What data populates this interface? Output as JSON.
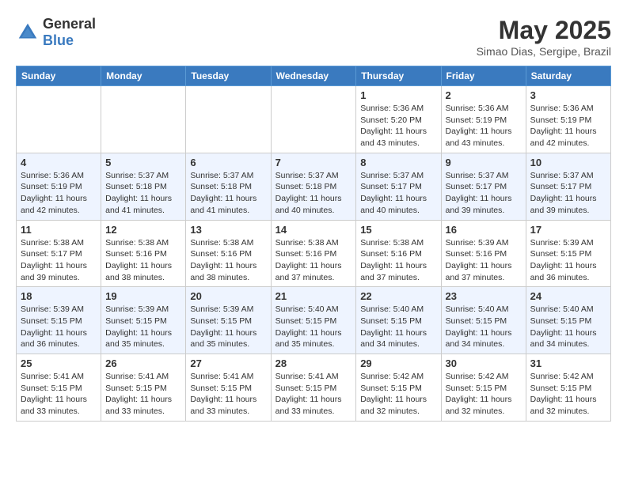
{
  "header": {
    "logo_general": "General",
    "logo_blue": "Blue",
    "month": "May 2025",
    "location": "Simao Dias, Sergipe, Brazil"
  },
  "days_of_week": [
    "Sunday",
    "Monday",
    "Tuesday",
    "Wednesday",
    "Thursday",
    "Friday",
    "Saturday"
  ],
  "weeks": [
    [
      {
        "day": "",
        "info": ""
      },
      {
        "day": "",
        "info": ""
      },
      {
        "day": "",
        "info": ""
      },
      {
        "day": "",
        "info": ""
      },
      {
        "day": "1",
        "info": "Sunrise: 5:36 AM\nSunset: 5:20 PM\nDaylight: 11 hours\nand 43 minutes."
      },
      {
        "day": "2",
        "info": "Sunrise: 5:36 AM\nSunset: 5:19 PM\nDaylight: 11 hours\nand 43 minutes."
      },
      {
        "day": "3",
        "info": "Sunrise: 5:36 AM\nSunset: 5:19 PM\nDaylight: 11 hours\nand 42 minutes."
      }
    ],
    [
      {
        "day": "4",
        "info": "Sunrise: 5:36 AM\nSunset: 5:19 PM\nDaylight: 11 hours\nand 42 minutes."
      },
      {
        "day": "5",
        "info": "Sunrise: 5:37 AM\nSunset: 5:18 PM\nDaylight: 11 hours\nand 41 minutes."
      },
      {
        "day": "6",
        "info": "Sunrise: 5:37 AM\nSunset: 5:18 PM\nDaylight: 11 hours\nand 41 minutes."
      },
      {
        "day": "7",
        "info": "Sunrise: 5:37 AM\nSunset: 5:18 PM\nDaylight: 11 hours\nand 40 minutes."
      },
      {
        "day": "8",
        "info": "Sunrise: 5:37 AM\nSunset: 5:17 PM\nDaylight: 11 hours\nand 40 minutes."
      },
      {
        "day": "9",
        "info": "Sunrise: 5:37 AM\nSunset: 5:17 PM\nDaylight: 11 hours\nand 39 minutes."
      },
      {
        "day": "10",
        "info": "Sunrise: 5:37 AM\nSunset: 5:17 PM\nDaylight: 11 hours\nand 39 minutes."
      }
    ],
    [
      {
        "day": "11",
        "info": "Sunrise: 5:38 AM\nSunset: 5:17 PM\nDaylight: 11 hours\nand 39 minutes."
      },
      {
        "day": "12",
        "info": "Sunrise: 5:38 AM\nSunset: 5:16 PM\nDaylight: 11 hours\nand 38 minutes."
      },
      {
        "day": "13",
        "info": "Sunrise: 5:38 AM\nSunset: 5:16 PM\nDaylight: 11 hours\nand 38 minutes."
      },
      {
        "day": "14",
        "info": "Sunrise: 5:38 AM\nSunset: 5:16 PM\nDaylight: 11 hours\nand 37 minutes."
      },
      {
        "day": "15",
        "info": "Sunrise: 5:38 AM\nSunset: 5:16 PM\nDaylight: 11 hours\nand 37 minutes."
      },
      {
        "day": "16",
        "info": "Sunrise: 5:39 AM\nSunset: 5:16 PM\nDaylight: 11 hours\nand 37 minutes."
      },
      {
        "day": "17",
        "info": "Sunrise: 5:39 AM\nSunset: 5:15 PM\nDaylight: 11 hours\nand 36 minutes."
      }
    ],
    [
      {
        "day": "18",
        "info": "Sunrise: 5:39 AM\nSunset: 5:15 PM\nDaylight: 11 hours\nand 36 minutes."
      },
      {
        "day": "19",
        "info": "Sunrise: 5:39 AM\nSunset: 5:15 PM\nDaylight: 11 hours\nand 35 minutes."
      },
      {
        "day": "20",
        "info": "Sunrise: 5:39 AM\nSunset: 5:15 PM\nDaylight: 11 hours\nand 35 minutes."
      },
      {
        "day": "21",
        "info": "Sunrise: 5:40 AM\nSunset: 5:15 PM\nDaylight: 11 hours\nand 35 minutes."
      },
      {
        "day": "22",
        "info": "Sunrise: 5:40 AM\nSunset: 5:15 PM\nDaylight: 11 hours\nand 34 minutes."
      },
      {
        "day": "23",
        "info": "Sunrise: 5:40 AM\nSunset: 5:15 PM\nDaylight: 11 hours\nand 34 minutes."
      },
      {
        "day": "24",
        "info": "Sunrise: 5:40 AM\nSunset: 5:15 PM\nDaylight: 11 hours\nand 34 minutes."
      }
    ],
    [
      {
        "day": "25",
        "info": "Sunrise: 5:41 AM\nSunset: 5:15 PM\nDaylight: 11 hours\nand 33 minutes."
      },
      {
        "day": "26",
        "info": "Sunrise: 5:41 AM\nSunset: 5:15 PM\nDaylight: 11 hours\nand 33 minutes."
      },
      {
        "day": "27",
        "info": "Sunrise: 5:41 AM\nSunset: 5:15 PM\nDaylight: 11 hours\nand 33 minutes."
      },
      {
        "day": "28",
        "info": "Sunrise: 5:41 AM\nSunset: 5:15 PM\nDaylight: 11 hours\nand 33 minutes."
      },
      {
        "day": "29",
        "info": "Sunrise: 5:42 AM\nSunset: 5:15 PM\nDaylight: 11 hours\nand 32 minutes."
      },
      {
        "day": "30",
        "info": "Sunrise: 5:42 AM\nSunset: 5:15 PM\nDaylight: 11 hours\nand 32 minutes."
      },
      {
        "day": "31",
        "info": "Sunrise: 5:42 AM\nSunset: 5:15 PM\nDaylight: 11 hours\nand 32 minutes."
      }
    ]
  ]
}
